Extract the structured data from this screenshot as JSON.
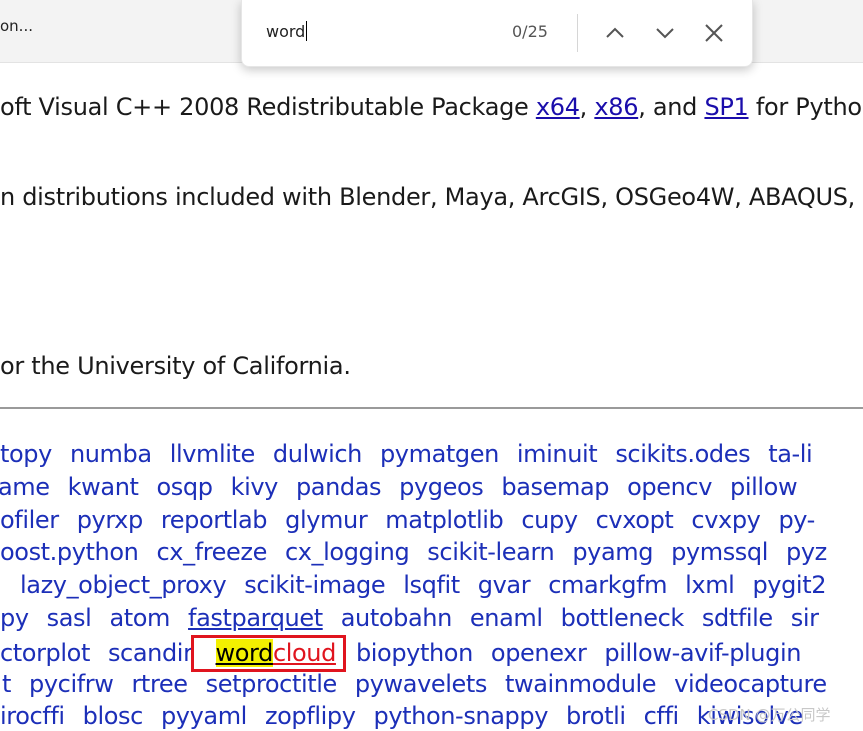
{
  "tab": {
    "title": "on..."
  },
  "find_bar": {
    "query": "word",
    "count": "0/25",
    "icons": {
      "prev": "chevron-up-icon",
      "next": "chevron-down-icon",
      "close": "close-icon"
    }
  },
  "content": {
    "line1": {
      "prefix": "oft Visual C++ 2008 Redistributable Package ",
      "link_x64": "x64",
      "sep1": ", ",
      "link_x86": "x86",
      "sep2": ", and ",
      "link_sp1": "SP1",
      "suffix": " for Pythor"
    },
    "line2": "n distributions included with Blender, Maya, ArcGIS, OSGeo4W, ABAQUS,",
    "line3": "or the University of California."
  },
  "packages": {
    "row1": [
      "topy",
      "numba",
      "llvmlite",
      "dulwich",
      "pymatgen",
      "iminuit",
      "scikits.odes",
      "ta-li"
    ],
    "row2": [
      "ame",
      "kwant",
      "osqp",
      "kivy",
      "pandas",
      "pygeos",
      "basemap",
      "opencv",
      "pillow"
    ],
    "row3": [
      "ofiler",
      "pyrxp",
      "reportlab",
      "glymur",
      "matplotlib",
      "cupy",
      "cvxopt",
      "cvxpy",
      "py-"
    ],
    "row4": [
      "oost.python",
      "cx_freeze",
      "cx_logging",
      "scikit-learn",
      "pyamg",
      "pymssql",
      "pyz"
    ],
    "row5": [
      "lazy_object_proxy",
      "scikit-image",
      "lsqfit",
      "gvar",
      "cmarkgfm",
      "lxml",
      "pygit2"
    ],
    "row6": [
      "py",
      "sasl",
      "atom",
      "fastparquet",
      "autobahn",
      "enaml",
      "bottleneck",
      "sdtfile",
      "sir"
    ],
    "row7_before": [
      "ctorplot",
      "scandir"
    ],
    "match": {
      "highlight": "word",
      "rest": "cloud"
    },
    "row7_after": [
      "biopython",
      "openexr",
      "pillow-avif-plugin"
    ],
    "row8": [
      "t",
      "pycifrw",
      "rtree",
      "setproctitle",
      "pywavelets",
      "twainmodule",
      "videocapture"
    ],
    "row9": [
      "irocffi",
      "blosc",
      "pyyaml",
      "zopflipy",
      "python-snappy",
      "brotli",
      "cffi",
      "kiwisolve"
    ]
  },
  "watermark": "CSDN @万公同学"
}
